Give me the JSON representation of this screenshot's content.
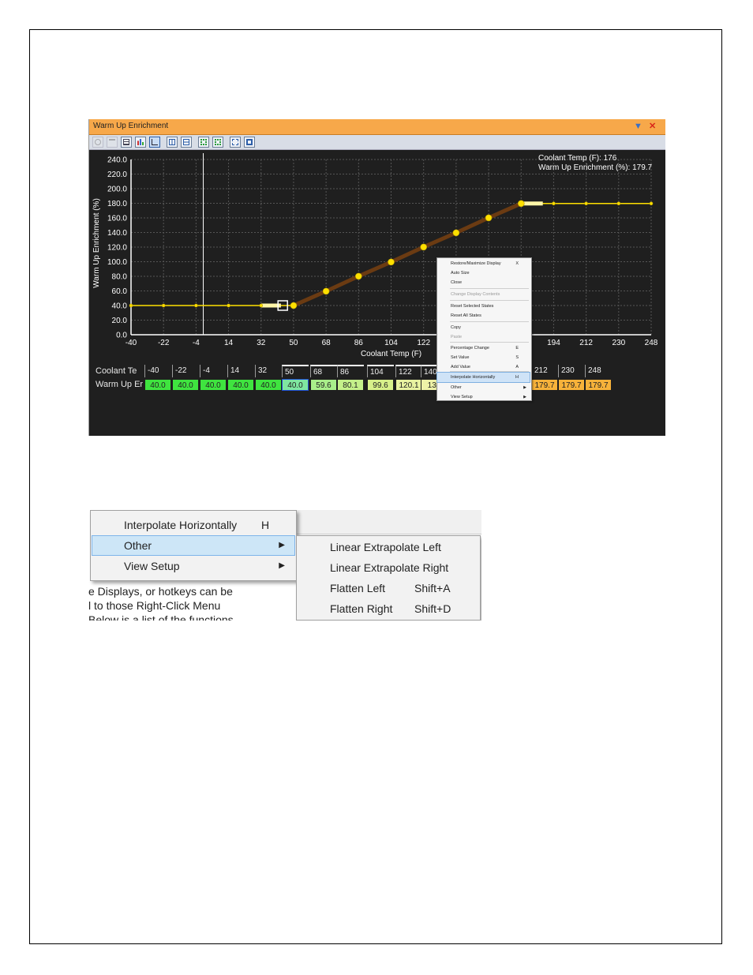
{
  "window": {
    "title": "Warm Up Enrichment"
  },
  "icons": {
    "titlebar": [
      "dropdown-arrow-icon",
      "close-icon"
    ],
    "toolbar": [
      "refresh-icon",
      "undo-icon",
      "table-view-icon",
      "bar-chart-icon",
      "line-chart-icon",
      "split-vertical-icon",
      "split-horizontal-icon",
      "zoom-fit-icon",
      "zoom-fit-alt-icon",
      "select-icon",
      "expand-icon"
    ]
  },
  "readout": {
    "coolant": "Coolant Temp (F): 176",
    "enrichment": "Warm Up Enrichment (%): 179.7"
  },
  "chart_data": {
    "type": "line",
    "xlabel": "Coolant Temp (F)",
    "ylabel": "Warm Up Enrichment (%)",
    "x_ticks": [
      "-40",
      "-22",
      "-4",
      "14",
      "32",
      "50",
      "68",
      "86",
      "104",
      "122",
      "140",
      "158",
      "176",
      "194",
      "212",
      "230",
      "248"
    ],
    "y_ticks": [
      "0.0",
      "20.0",
      "40.0",
      "60.0",
      "80.0",
      "100.0",
      "120.0",
      "140.0",
      "160.0",
      "180.0",
      "200.0",
      "220.0",
      "240.0"
    ],
    "xlim": [
      -40,
      248
    ],
    "ylim": [
      0,
      240
    ],
    "x": [
      -40,
      -22,
      -4,
      14,
      32,
      50,
      68,
      86,
      104,
      122,
      140,
      158,
      176,
      194,
      212,
      230,
      248
    ],
    "values": [
      40.0,
      40.0,
      40.0,
      40.0,
      40.0,
      40.0,
      59.6,
      80.1,
      99.6,
      120.1,
      139.6,
      160.1,
      179.7,
      179.7,
      179.7,
      179.7,
      179.7
    ],
    "selected_range": [
      50,
      176
    ],
    "cursor_x": 0,
    "grid": true,
    "colors": {
      "line": "#ffe000",
      "selection": "#6b3b12",
      "grid": "#555555"
    }
  },
  "table": {
    "row_labels": [
      "Coolant Te",
      "Warm Up Er"
    ],
    "headers": [
      "-40",
      "-22",
      "-4",
      "14",
      "32",
      "50",
      "68",
      "86",
      "104",
      "122",
      "140",
      "212",
      "230",
      "248"
    ],
    "values": [
      "40.0",
      "40.0",
      "40.0",
      "40.0",
      "40.0",
      "40.0",
      "59.6",
      "80.1",
      "99.6",
      "120.1",
      "139",
      "179.7",
      "179.7",
      "179.7"
    ],
    "cell_colors": [
      "#3fe43f",
      "#3fe43f",
      "#3fe43f",
      "#3fe43f",
      "#3fe43f",
      "#7fe6a0",
      "#a9ef8a",
      "#c4f08a",
      "#d7f08a",
      "#e8f2a0",
      "#eef2a8",
      "#f7b23a",
      "#f7b23a",
      "#f7b23a"
    ]
  },
  "context_menu": {
    "items": [
      {
        "label": "Restore/Maximize Display",
        "key": "X"
      },
      {
        "label": "Auto Size",
        "key": ""
      },
      {
        "label": "Close",
        "key": ""
      },
      {
        "label": "Change Display Contents",
        "key": ""
      },
      {
        "label": "Reset Selected States",
        "key": ""
      },
      {
        "label": "Reset All States",
        "key": ""
      },
      {
        "label": "Copy",
        "key": ""
      },
      {
        "label": "Paste",
        "key": ""
      },
      {
        "label": "Percentage Change",
        "key": "E"
      },
      {
        "label": "Set Value",
        "key": "S"
      },
      {
        "label": "Add Value",
        "key": "A"
      },
      {
        "label": "Interpolate Horizontally",
        "key": "H"
      },
      {
        "label": "Other",
        "key": ""
      },
      {
        "label": "View Setup",
        "key": ""
      }
    ]
  },
  "zoom_menu": {
    "items": [
      {
        "label": "Interpolate Horizontally",
        "key": "H"
      },
      {
        "label": "Other",
        "key": ""
      },
      {
        "label": "View Setup",
        "key": ""
      }
    ],
    "submenu": [
      {
        "label": "Linear Extrapolate Left",
        "key": ""
      },
      {
        "label": "Linear Extrapolate Right",
        "key": ""
      },
      {
        "label": "Flatten Left",
        "key": "Shift+A"
      },
      {
        "label": "Flatten Right",
        "key": "Shift+D"
      }
    ],
    "behind_text": [
      "e Displays, or hotkeys can be",
      "l to those Right-Click Menu",
      "Below is a list of the functions"
    ]
  }
}
